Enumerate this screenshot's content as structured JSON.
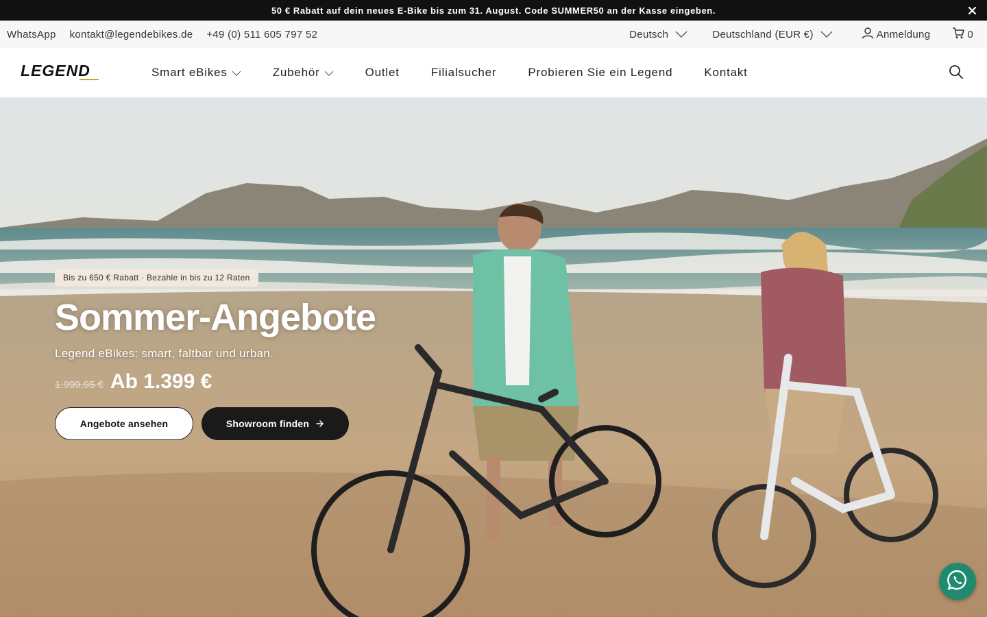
{
  "announcement": {
    "text_before": "50 € Rabatt auf dein neues E-Bike bis zum 31. August. Code ",
    "code": "SUMMER50",
    "text_after": " an der Kasse eingeben."
  },
  "utility": {
    "whatsapp": "WhatsApp",
    "email": "kontakt@legendebikes.de",
    "phone": "+49 (0) 511 605 797 52",
    "language": "Deutsch",
    "country": "Deutschland (EUR €)",
    "login": "Anmeldung",
    "cart_count": "0"
  },
  "nav": {
    "items": [
      {
        "label": "Smart eBikes"
      },
      {
        "label": "Zubehör"
      },
      {
        "label": "Outlet"
      },
      {
        "label": "Filialsucher"
      },
      {
        "label": "Probieren Sie ein Legend"
      },
      {
        "label": "Kontakt"
      }
    ]
  },
  "hero": {
    "badge": "Bis zu 650 € Rabatt · Bezahle in bis zu 12 Raten",
    "title": "Sommer-Angebote",
    "subtitle": "Legend eBikes: smart, faltbar und urban.",
    "old_price": "1.999,95 €",
    "new_price": "Ab 1.399 €",
    "primary_button": "Angebote ansehen",
    "secondary_button": "Showroom finden"
  },
  "icons": [
    "close-icon",
    "chevron-down-icon",
    "user-icon",
    "cart-icon",
    "search-icon",
    "arrow-right-icon",
    "whatsapp-icon"
  ],
  "colors": {
    "announcement_bg": "#111111",
    "utility_bg": "#f7f7f7",
    "badge_bg": "#f1e9df",
    "dark_button": "#1a1a1a",
    "whatsapp": "#1f8a6e"
  }
}
